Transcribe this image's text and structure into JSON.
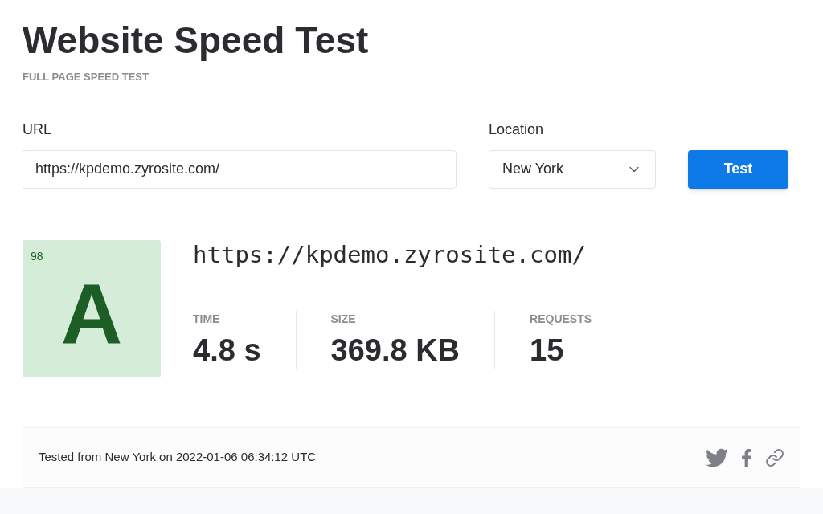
{
  "header": {
    "title": "Website Speed Test",
    "subtitle": "FULL PAGE SPEED TEST"
  },
  "form": {
    "url_label": "URL",
    "url_value": "https://kpdemo.zyrosite.com/",
    "location_label": "Location",
    "location_value": "New York",
    "button": "Test"
  },
  "result": {
    "score": "98",
    "grade": "A",
    "url": "https://kpdemo.zyrosite.com/",
    "metrics": [
      {
        "label": "TIME",
        "value": "4.8 s"
      },
      {
        "label": "SIZE",
        "value": "369.8 KB"
      },
      {
        "label": "REQUESTS",
        "value": "15"
      }
    ]
  },
  "footer": {
    "text": "Tested from New York on 2022-01-06 06:34:12 UTC"
  }
}
